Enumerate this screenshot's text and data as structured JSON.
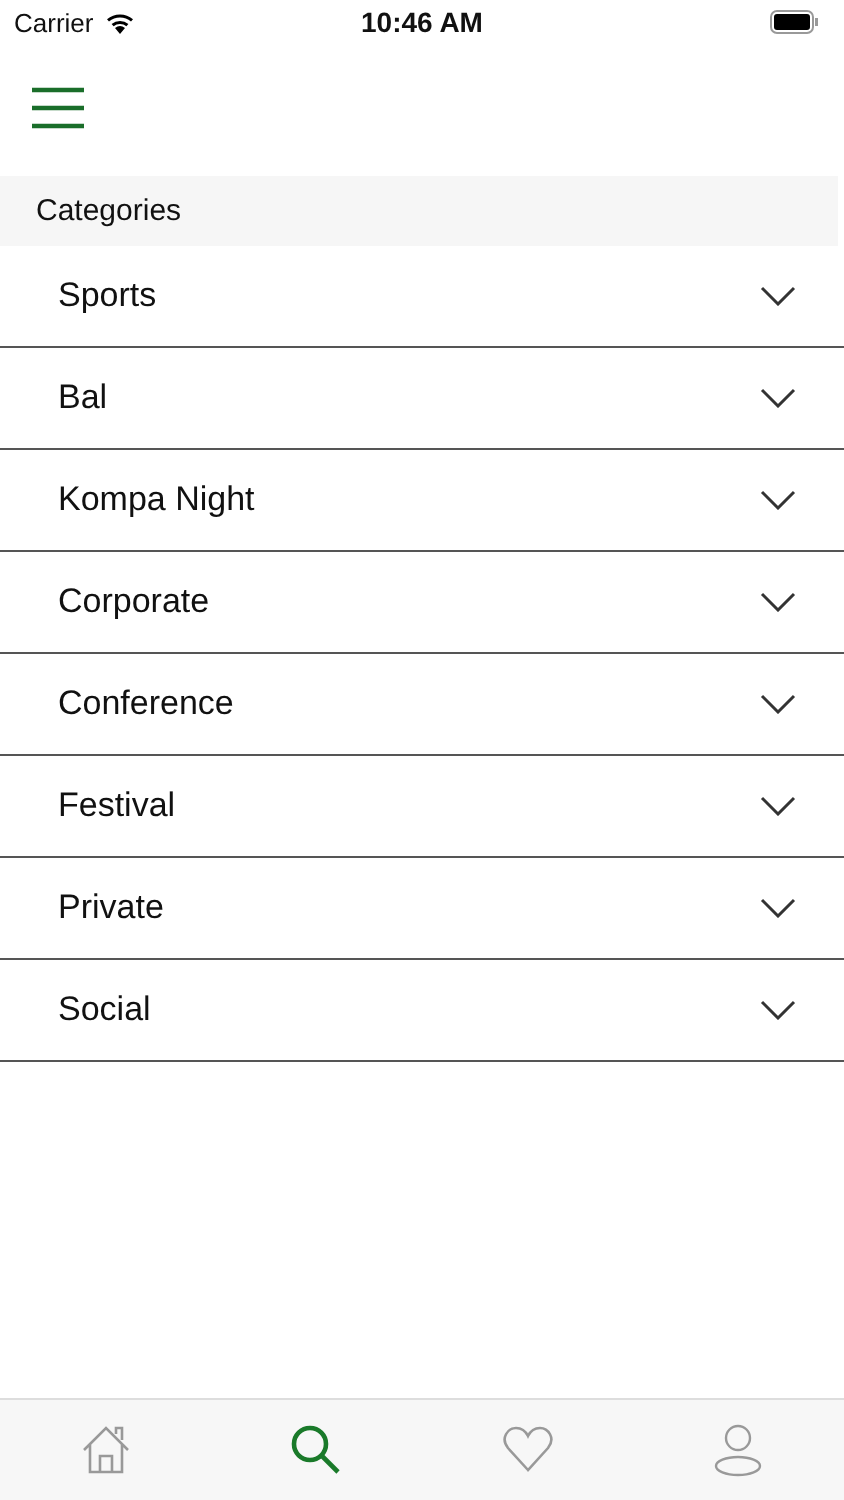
{
  "status_bar": {
    "carrier": "Carrier",
    "time": "10:46 AM"
  },
  "section_title": "Categories",
  "categories": [
    {
      "label": "Sports",
      "expanded": false
    },
    {
      "label": "Bal",
      "expanded": false
    },
    {
      "label": "Kompa Night",
      "expanded": false
    },
    {
      "label": "Corporate",
      "expanded": false
    },
    {
      "label": "Conference",
      "expanded": false
    },
    {
      "label": "Festival",
      "expanded": false
    },
    {
      "label": "Private",
      "expanded": false
    },
    {
      "label": "Social",
      "expanded": false
    }
  ],
  "tab_bar": [
    {
      "kind": "home",
      "selected": false
    },
    {
      "kind": "search",
      "selected": true
    },
    {
      "kind": "favorites",
      "selected": false
    },
    {
      "kind": "profile",
      "selected": false
    }
  ]
}
